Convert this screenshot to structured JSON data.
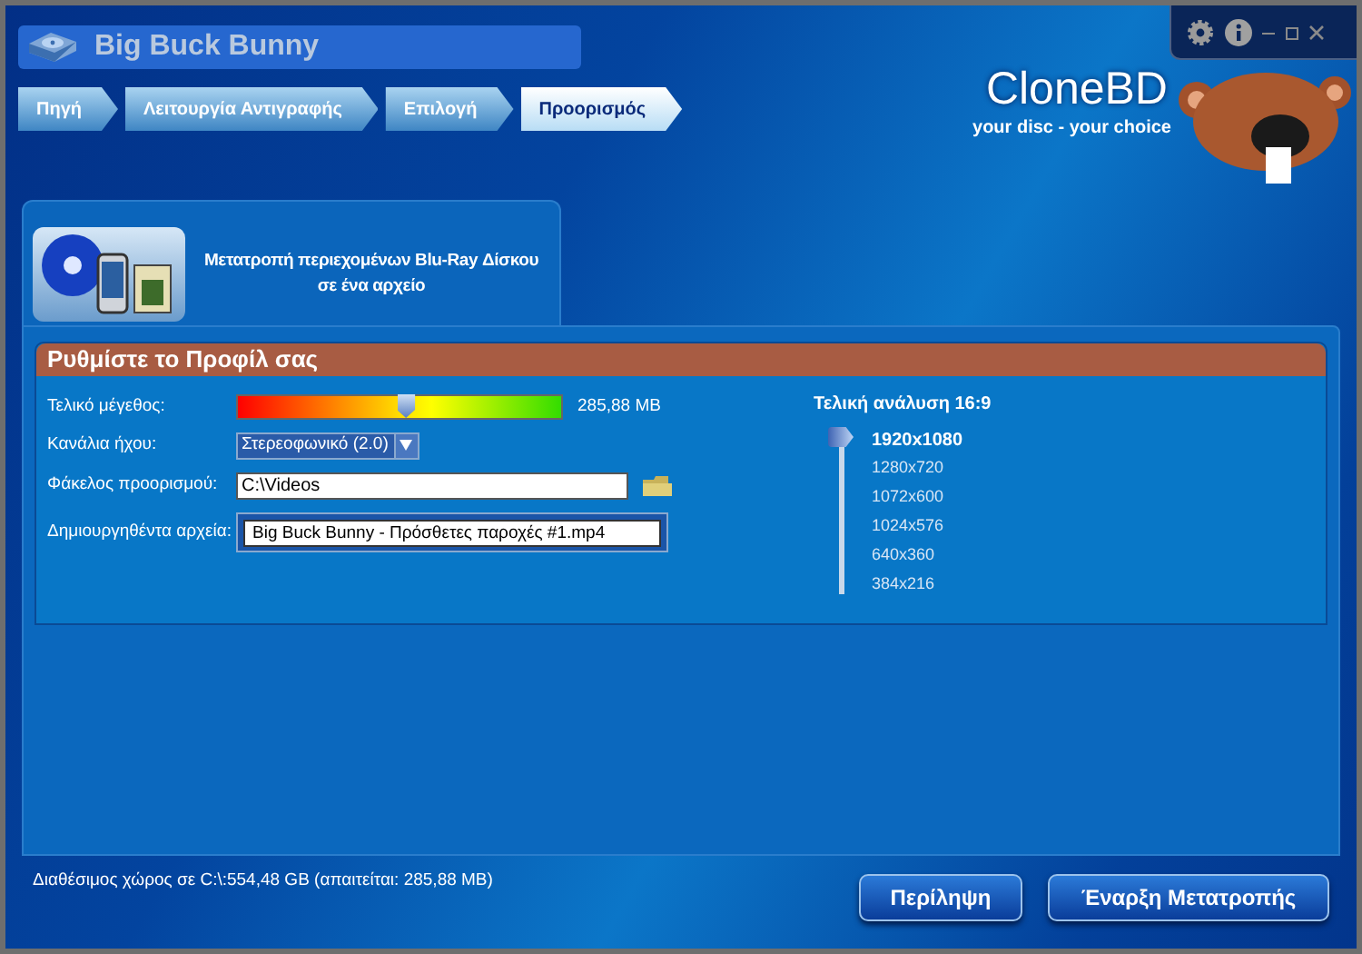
{
  "window": {
    "title": "Big Buck Bunny"
  },
  "steps": [
    {
      "label": "Πηγή",
      "selected": false
    },
    {
      "label": "Λειτουργία Αντιγραφής",
      "selected": false
    },
    {
      "label": "Επιλογή",
      "selected": false
    },
    {
      "label": "Προορισμός",
      "selected": true
    }
  ],
  "logo": {
    "name": "CloneBD",
    "tagline": "your disc - your choice"
  },
  "task": {
    "description": "Μετατροπή περιεχομένων Blu-Ray Δίσκου σε ένα αρχείο"
  },
  "profile": {
    "title": "Ρυθμίστε το Προφίλ σας",
    "fields": [
      {
        "kind": "slider",
        "label": "Τελικό μέγεθος:",
        "level": 0.52,
        "reading": "285,88 MB"
      },
      {
        "kind": "dropdown",
        "label": "Κανάλια ήχου:",
        "value": "Στερεοφωνικό (2.0)"
      },
      {
        "kind": "folder",
        "label": "Φάκελος προορισμού:",
        "value": "C:\\Videos"
      },
      {
        "kind": "file",
        "label": "Δημιουργηθέντα αρχεία:",
        "value": "Big Buck Bunny - Πρόσθετες παροχές #1.mp4"
      }
    ],
    "resolution": {
      "title": "Τελική ανάλυση 16:9",
      "options": [
        {
          "label": "1920x1080",
          "selected": true
        },
        {
          "label": "1280x720",
          "selected": false
        },
        {
          "label": "1072x600",
          "selected": false
        },
        {
          "label": "1024x576",
          "selected": false
        },
        {
          "label": "640x360",
          "selected": false
        },
        {
          "label": "384x216",
          "selected": false
        }
      ]
    }
  },
  "status_bar": {
    "text": "Διαθέσιμος χώρος σε C:\\:554,48 GB (απαιτείται: 285,88 MB)"
  },
  "buttons": [
    "Περίληψη",
    "Έναρξη Μετατροπής"
  ]
}
